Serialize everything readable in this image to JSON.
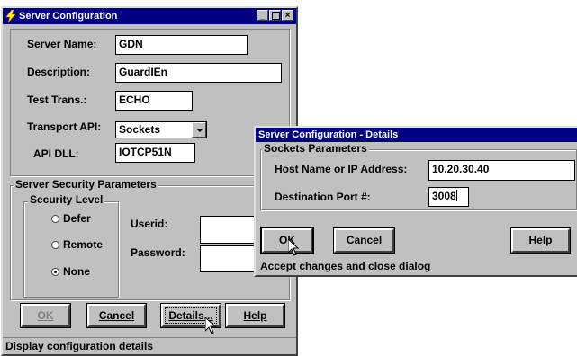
{
  "main_window": {
    "title": "Server Configuration",
    "labels": {
      "server_name": "Server Name:",
      "description": "Description:",
      "test_trans": "Test Trans.:",
      "transport_api": "Transport API:",
      "api_dll": "API DLL:"
    },
    "values": {
      "server_name": "GDN",
      "description": "GuardIEn",
      "test_trans": "ECHO",
      "transport_api": "Sockets",
      "api_dll": "IOTCP51N"
    },
    "security": {
      "group_title": "Server Security Parameters",
      "level_title": "Security Level",
      "options": [
        "Defer",
        "Remote",
        "None"
      ],
      "selected": "None",
      "userid_label": "Userid:",
      "password_label": "Password:",
      "userid_value": "",
      "password_value": ""
    },
    "buttons": {
      "ok": "OK",
      "cancel": "Cancel",
      "details": "Details...",
      "help": "Help"
    },
    "status": "Display configuration details"
  },
  "details_window": {
    "title": "Server Configuration - Details",
    "group_title": "Sockets Parameters",
    "host_label": "Host Name or IP Address:",
    "host_value": "10.20.30.40",
    "port_label": "Destination Port #:",
    "port_value": "3008",
    "buttons": {
      "ok": "OK",
      "cancel": "Cancel",
      "help": "Help"
    },
    "status": "Accept changes and close dialog"
  },
  "colors": {
    "titlebar": "#000080",
    "face": "#c0c0c0"
  }
}
